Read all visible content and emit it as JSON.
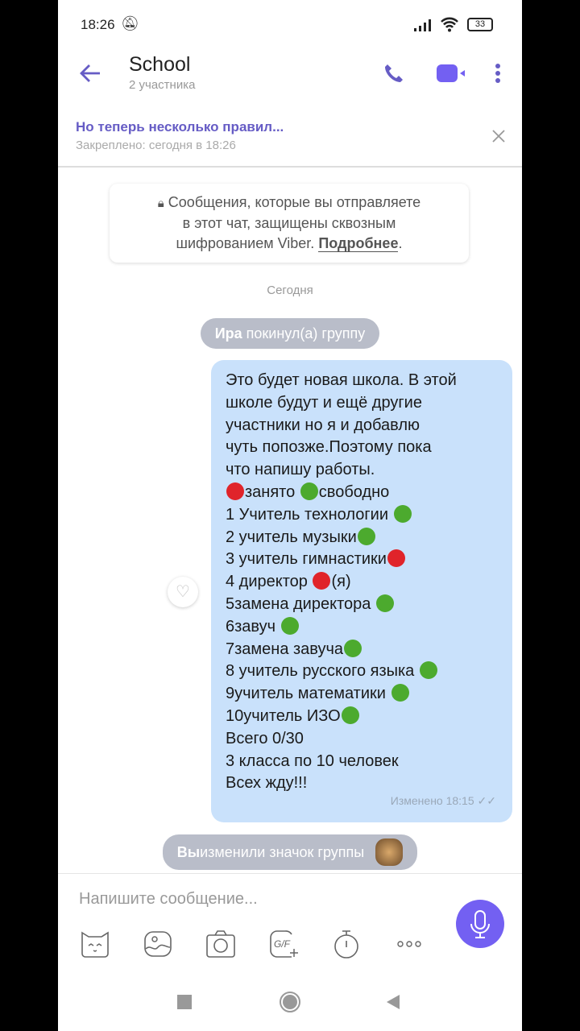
{
  "status": {
    "time": "18:26",
    "battery": "33"
  },
  "header": {
    "title": "School",
    "subtitle": "2 участника",
    "icons": [
      "back-arrow",
      "phone",
      "video",
      "more-vertical"
    ]
  },
  "pinned": {
    "title": "Но теперь несколько правил...",
    "subtitle": "Закреплено: сегодня в 18:26"
  },
  "e2e": {
    "line1": "Сообщения, которые вы отправляете",
    "line2": "в этот чат, защищены сквозным",
    "line3": "шифрованием Viber.",
    "link": "Подробнее",
    "end": "."
  },
  "date_label": "Сегодня",
  "system1": {
    "name": "Ира",
    "text": " покинул(а) группу"
  },
  "message": {
    "lines": [
      [
        {
          "t": "Это будет новая школа. В этой"
        }
      ],
      [
        {
          "t": "школе будут и ещё другие"
        }
      ],
      [
        {
          "t": "участники но я и добавлю"
        }
      ],
      [
        {
          "t": "чуть попозже.Поэтому пока"
        }
      ],
      [
        {
          "t": "что напишу работы."
        }
      ],
      [
        {
          "dot": "red"
        },
        {
          "t": "занято "
        },
        {
          "dot": "green"
        },
        {
          "t": "свободно"
        }
      ],
      [
        {
          "t": "1 Учитель технологии "
        },
        {
          "dot": "green"
        }
      ],
      [
        {
          "t": "2 учитель музыки"
        },
        {
          "dot": "green"
        }
      ],
      [
        {
          "t": "3 учитель гимнастики"
        },
        {
          "dot": "red"
        }
      ],
      [
        {
          "t": "4 директор "
        },
        {
          "dot": "red"
        },
        {
          "t": "(я)"
        }
      ],
      [
        {
          "t": "5замена директора "
        },
        {
          "dot": "green"
        }
      ],
      [
        {
          "t": "6завуч "
        },
        {
          "dot": "green"
        }
      ],
      [
        {
          "t": "7замена завуча"
        },
        {
          "dot": "green"
        }
      ],
      [
        {
          "t": "8 учитель русского языка "
        },
        {
          "dot": "green"
        }
      ],
      [
        {
          "t": "9учитель математики "
        },
        {
          "dot": "green"
        }
      ],
      [
        {
          "t": "10учитель ИЗО"
        },
        {
          "dot": "green"
        }
      ],
      [
        {
          "t": "Всего 0/30"
        }
      ],
      [
        {
          "t": "3 класса по 10 человек"
        }
      ],
      [
        {
          "t": "Всех жду!!!"
        }
      ]
    ],
    "edited": "Изменено 18:15"
  },
  "system2": {
    "name": "Вы",
    "text": " изменили значок группы"
  },
  "composer": {
    "placeholder": "Напишите сообщение..."
  },
  "colors": {
    "accent": "#7360f2",
    "bubble": "#c9e1fb",
    "red_dot": "#e0242a",
    "green_dot": "#4caa2e"
  }
}
